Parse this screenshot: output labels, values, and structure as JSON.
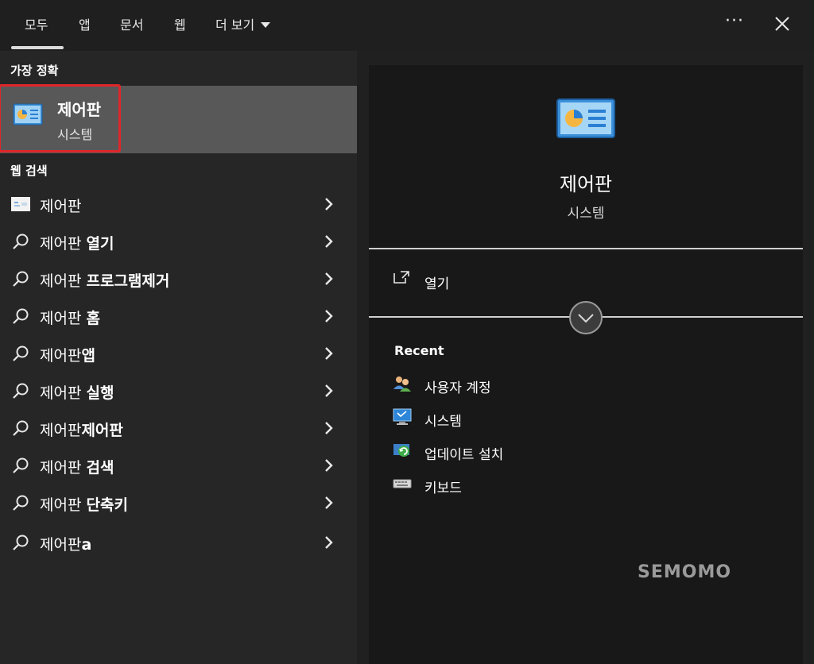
{
  "tabs": [
    {
      "label": "모두",
      "active": true
    },
    {
      "label": "앱"
    },
    {
      "label": "문서"
    },
    {
      "label": "웹"
    },
    {
      "label": "더 보기"
    }
  ],
  "toolbar": {
    "more_label": "···",
    "close_icon": "close-icon"
  },
  "best_match": {
    "section_title": "가장 정확",
    "title": "제어판",
    "subtitle": "시스템",
    "icon": "control-panel-icon"
  },
  "web_search": {
    "section_title": "웹 검색",
    "items": [
      {
        "normal": "제어판",
        "bold": "",
        "icon": "web-thumbnail-icon"
      },
      {
        "normal": "제어판 ",
        "bold": "열기",
        "icon": "search-icon"
      },
      {
        "normal": "제어판 ",
        "bold": "프로그램제거",
        "icon": "search-icon"
      },
      {
        "normal": "제어판 ",
        "bold": "홈",
        "icon": "search-icon"
      },
      {
        "normal": "제어판",
        "bold": "앱",
        "icon": "search-icon"
      },
      {
        "normal": "제어판 ",
        "bold": "실행",
        "icon": "search-icon"
      },
      {
        "normal": "제어판",
        "bold": "제어판",
        "icon": "search-icon"
      },
      {
        "normal": "제어판 ",
        "bold": "검색",
        "icon": "search-icon"
      },
      {
        "normal": "제어판 ",
        "bold": "단축키",
        "icon": "search-icon"
      },
      {
        "normal": "제어판",
        "bold": "a",
        "icon": "search-icon"
      }
    ]
  },
  "preview": {
    "title": "제어판",
    "subtitle": "시스템",
    "open_label": "열기",
    "recent_title": "Recent",
    "recent": [
      {
        "label": "사용자 계정",
        "icon": "user-accounts-icon"
      },
      {
        "label": "시스템",
        "icon": "system-monitor-icon"
      },
      {
        "label": "업데이트 설치",
        "icon": "windows-update-icon"
      },
      {
        "label": "키보드",
        "icon": "keyboard-icon"
      }
    ]
  },
  "watermark": "SEMOMO",
  "colors": {
    "highlight_border": "#e0262a",
    "selected_bg": "#585858",
    "panel_bg": "#181818"
  }
}
